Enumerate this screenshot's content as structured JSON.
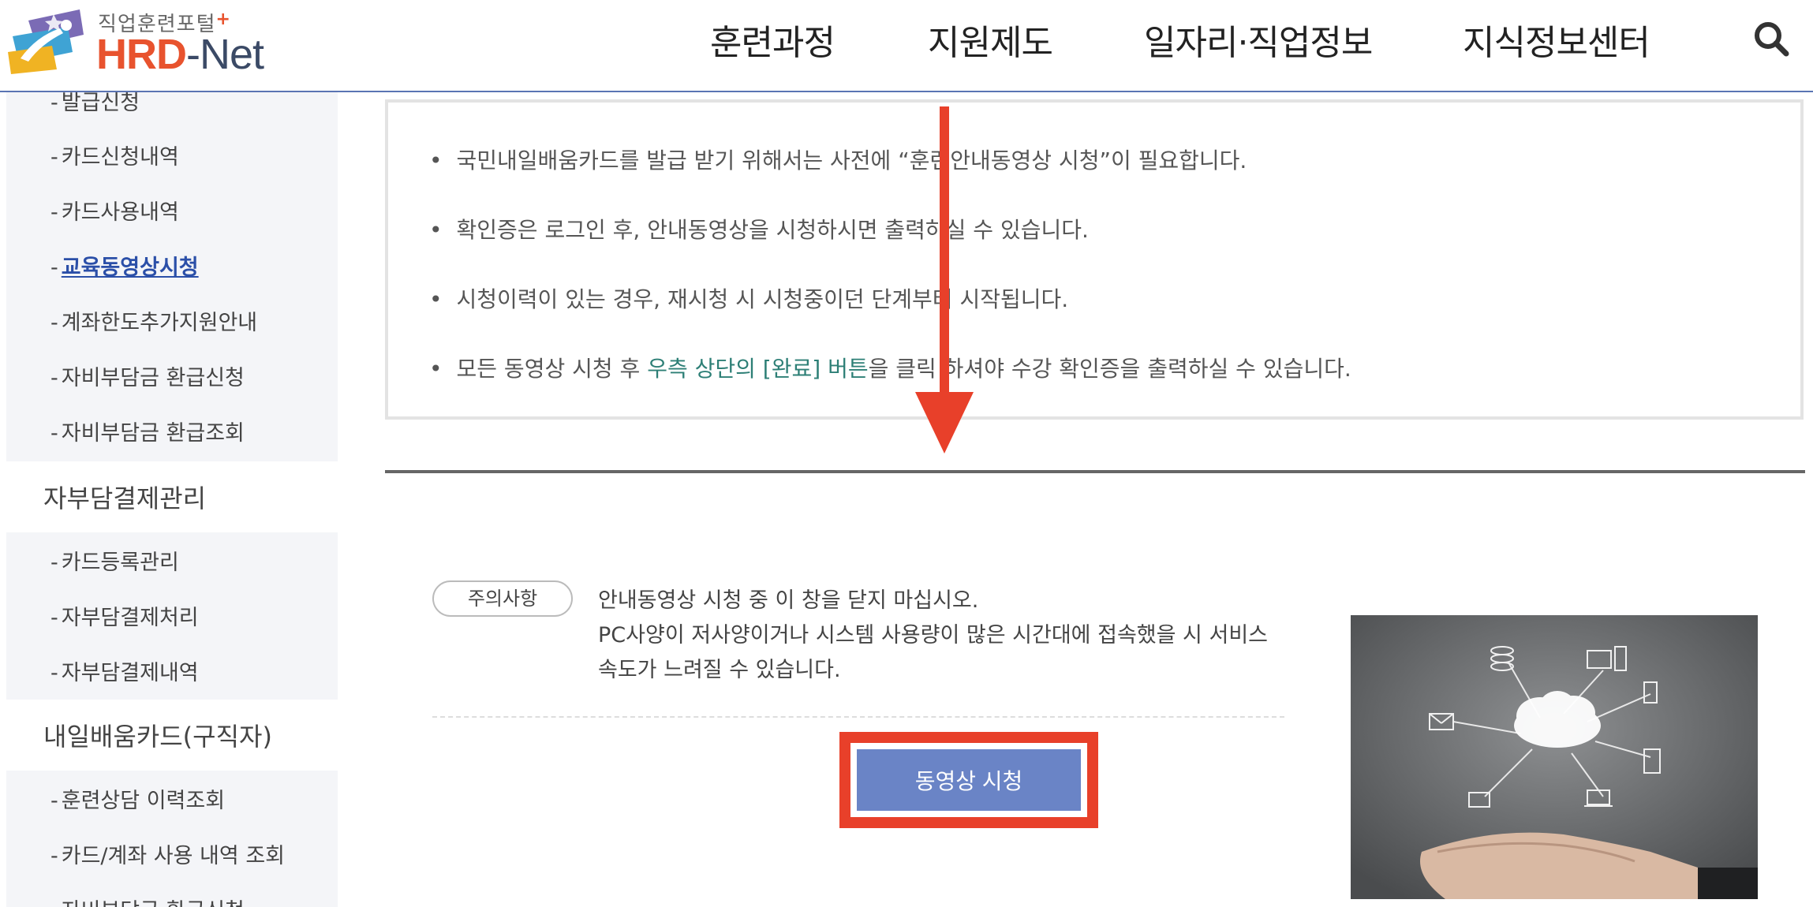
{
  "header": {
    "logo_small": "직업훈련포털",
    "logo_plus": "+",
    "logo_hrd": "HRD",
    "logo_net": "-Net",
    "nav": [
      "훈련과정",
      "지원제도",
      "일자리·직업정보",
      "지식정보센터"
    ],
    "search_icon": "search-icon"
  },
  "sidebar": {
    "group1_items": [
      {
        "label": "발급신청"
      },
      {
        "label": "카드신청내역"
      },
      {
        "label": "카드사용내역"
      },
      {
        "label": "교육동영상시청",
        "active": true
      },
      {
        "label": "계좌한도추가지원안내"
      },
      {
        "label": "자비부담금 환급신청"
      },
      {
        "label": "자비부담금 환급조회"
      }
    ],
    "heading2": "자부담결제관리",
    "group2_items": [
      {
        "label": "카드등록관리"
      },
      {
        "label": "자부담결제처리"
      },
      {
        "label": "자부담결제내역"
      }
    ],
    "heading3": "내일배움카드(구직자)",
    "group3_items": [
      {
        "label": "훈련상담 이력조회"
      },
      {
        "label": "카드/계좌 사용 내역 조회"
      },
      {
        "label": "자비부담금 환급신청"
      }
    ]
  },
  "notice": {
    "bullet": "•",
    "line1": "국민내일배움카드를 발급 받기 위해서는 사전에 “훈련안내동영상 시청”이 필요합니다.",
    "line2": "확인증은 로그인 후, 안내동영상을 시청하시면 출력하실 수 있습니다.",
    "line3": "시청이력이 있는 경우, 재시청 시 시청중이던 단계부터 시작됩니다.",
    "line4_pre": "모든 동영상 시청 후 ",
    "line4_hl": "우측 상단의 [완료] 버튼",
    "line4_post": "을 클릭 하셔야 수강 확인증을 출력하실 수 있습니다."
  },
  "caution": {
    "badge": "주의사항",
    "line1": "안내동영상 시청 중 이 창을 닫지 마십시오.",
    "line2": "PC사양이 저사양이거나 시스템 사용량이 많은 시간대에 접속했을 시 서비스 속도가 느려질 수 있습니다."
  },
  "video_button": "동영상 시청",
  "colors": {
    "accent_red": "#e8402a",
    "button_blue": "#6a84c6",
    "highlight_teal": "#2d7f76",
    "active_link": "#2b4fa8"
  }
}
